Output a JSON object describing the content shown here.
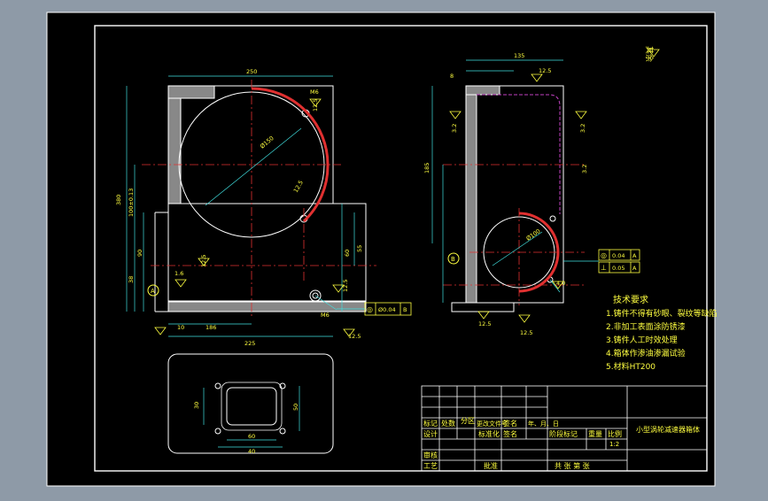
{
  "colors": {
    "background": "#8e9aa7",
    "sheet": "#000000",
    "line": "#ffffff",
    "centerline": "#e03030",
    "hidden": "#c040c0",
    "dimension": "#40e0e0",
    "text": "#ffff40"
  },
  "front_view": {
    "dims": {
      "overall_width": "250",
      "height": "380",
      "height_tol": "100±0.13",
      "bore_dia": "Ø150",
      "base_width": "225",
      "left_low": "10",
      "base_h": "38",
      "step_h": "90",
      "right_step": "60",
      "right_h": "55",
      "dim_mid": "186",
      "hole": "M6",
      "hole2": "M6",
      "small_tol": "1.6",
      "r1": "12.5",
      "r2": "12.5",
      "r3": "12.5",
      "r4": "12.5",
      "r5": "12.5",
      "label_a": "A"
    },
    "gdt": {
      "symbol": "◎",
      "value": "Ø0.04",
      "datum": "B"
    }
  },
  "side_view": {
    "dims": {
      "top": "135",
      "top2": "8",
      "r_top": "12.5",
      "left_a": "3.2",
      "left_b": "185",
      "right_a": "3.2",
      "right_b": "3.2",
      "bore_dia": "Ø100",
      "br1": "12.5",
      "br2": "12.5",
      "r_low": "4.0",
      "label_b": "B"
    },
    "gdt": [
      {
        "symbol": "◎",
        "value": "0.04",
        "datum": "A"
      },
      {
        "symbol": "⊥",
        "value": "0.05",
        "datum": "A"
      }
    ]
  },
  "bottom_view": {
    "dims": {
      "w1": "60",
      "w2": "40",
      "h1": "30",
      "h2": "50"
    }
  },
  "corner_note": "其余",
  "tech_requirements": {
    "title": "技术要求",
    "items": [
      "1.铸件不得有砂眼、裂纹等缺陷",
      "2.非加工表面涂防锈漆",
      "3.铸件人工时效处理",
      "4.箱体作渗油渗漏试验",
      "5.材料HT200"
    ]
  },
  "title_block": {
    "part_name": "小型涡轮减速器箱体",
    "row_a": [
      "标记",
      "处数",
      "分区",
      "更改文件号",
      "签名",
      "年、月、日"
    ],
    "row_b": [
      "设计",
      "",
      "标准化",
      "签名"
    ],
    "row_c": [
      "阶段标记",
      "重量",
      "比例"
    ],
    "scale": "1:2",
    "row_d": [
      "审核",
      "工艺",
      "批准"
    ],
    "sheets": "共 张   第 张"
  }
}
